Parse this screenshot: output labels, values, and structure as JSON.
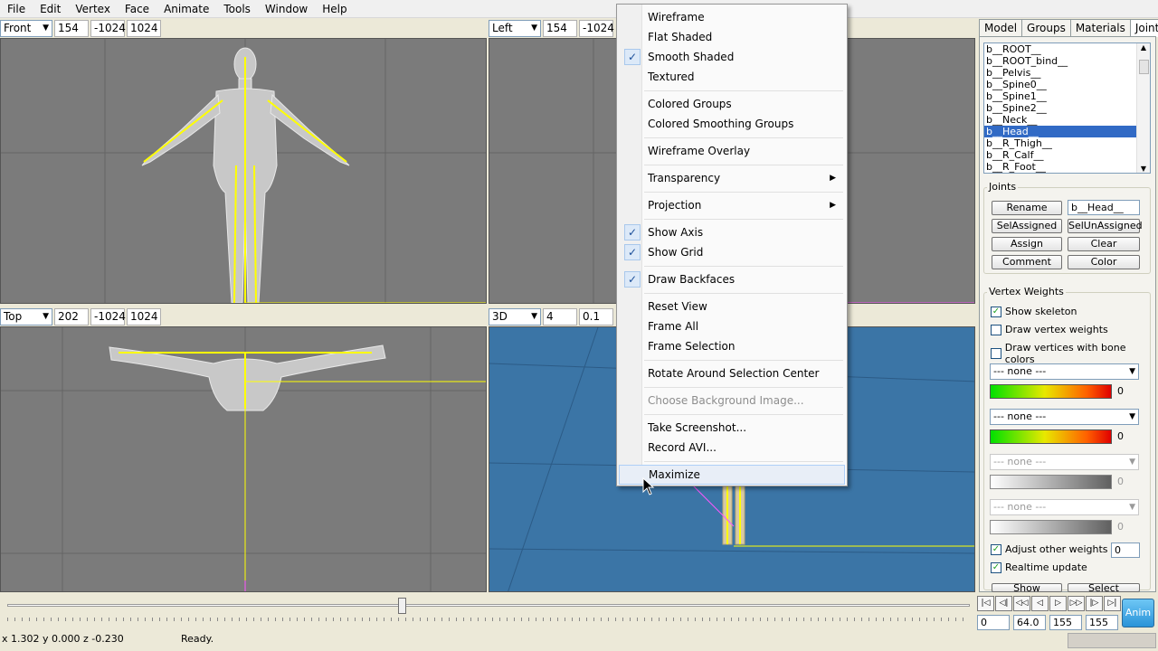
{
  "menubar": [
    "File",
    "Edit",
    "Vertex",
    "Face",
    "Animate",
    "Tools",
    "Window",
    "Help"
  ],
  "viewports": {
    "front": {
      "label": "Front",
      "v1": "154",
      "v2": "-1024",
      "v3": "1024"
    },
    "left": {
      "label": "Left",
      "v1": "154",
      "v2": "-1024"
    },
    "top": {
      "label": "Top",
      "v1": "202",
      "v2": "-1024",
      "v3": "1024"
    },
    "persp": {
      "label": "3D",
      "v1": "4",
      "v2": "0.1"
    }
  },
  "context_menu": {
    "items": [
      {
        "label": "Wireframe"
      },
      {
        "label": "Flat Shaded"
      },
      {
        "label": "Smooth Shaded",
        "checked": true
      },
      {
        "label": "Textured"
      },
      {
        "label": "Colored Groups"
      },
      {
        "label": "Colored Smoothing Groups"
      },
      {
        "label": "Wireframe Overlay"
      },
      {
        "label": "Transparency",
        "submenu": true
      },
      {
        "label": "Projection",
        "submenu": true
      },
      {
        "label": "Show Axis",
        "checked": true
      },
      {
        "label": "Show Grid",
        "checked": true
      },
      {
        "label": "Draw Backfaces",
        "checked": true
      },
      {
        "label": "Reset View"
      },
      {
        "label": "Frame All"
      },
      {
        "label": "Frame Selection"
      },
      {
        "label": "Rotate Around Selection Center"
      },
      {
        "label": "Choose Background Image...",
        "disabled": true
      },
      {
        "label": "Take Screenshot..."
      },
      {
        "label": "Record AVI..."
      },
      {
        "label": "Maximize",
        "hover": true
      }
    ]
  },
  "tabs": [
    "Model",
    "Groups",
    "Materials",
    "Joints"
  ],
  "joints_list": [
    "b__ROOT__",
    "b__ROOT_bind__",
    "b__Pelvis__",
    "b__Spine0__",
    "b__Spine1__",
    "b__Spine2__",
    "b__Neck__",
    "b__Head__",
    "b__R_Thigh__",
    "b__R_Calf__",
    "b__R_Foot__"
  ],
  "joints_selected": "b__Head__",
  "joints_group": {
    "label": "Joints",
    "rename": "Rename",
    "name_value": "b__Head__",
    "sel_assigned": "SelAssigned",
    "sel_unassigned": "SelUnAssigned",
    "assign": "Assign",
    "clear": "Clear",
    "comment": "Comment",
    "color": "Color"
  },
  "vertex_weights": {
    "label": "Vertex Weights",
    "show_skeleton": "Show skeleton",
    "draw_vertex_weights": "Draw vertex weights",
    "draw_bone_colors": "Draw vertices with bone colors",
    "none1": "--- none ---",
    "none2": "--- none ---",
    "none3": "--- none ---",
    "none4": "--- none ---",
    "w1": "0",
    "w2": "0",
    "w3": "0",
    "w4": "0",
    "adjust_other": "Adjust other weights",
    "adjust_value": "0",
    "realtime": "Realtime update",
    "show": "Show",
    "select": "Select"
  },
  "timeline": {
    "position": 0.41
  },
  "anim": {
    "f1": "0",
    "f2": "64.0",
    "f3": "155",
    "f4": "155",
    "anim_label": "Anim",
    "nav": [
      "|◁",
      "◁|",
      "◁◁",
      "◁",
      "▷",
      "▷▷",
      "|▷",
      "▷|"
    ]
  },
  "status": {
    "coords": "x 1.302 y 0.000 z -0.230",
    "text": "Ready."
  },
  "colors": {
    "viewport_gray": "#7b7b7b",
    "viewport_3d": "#3b75a6",
    "skeleton": "#ffff00",
    "selection": "#316ac5"
  }
}
